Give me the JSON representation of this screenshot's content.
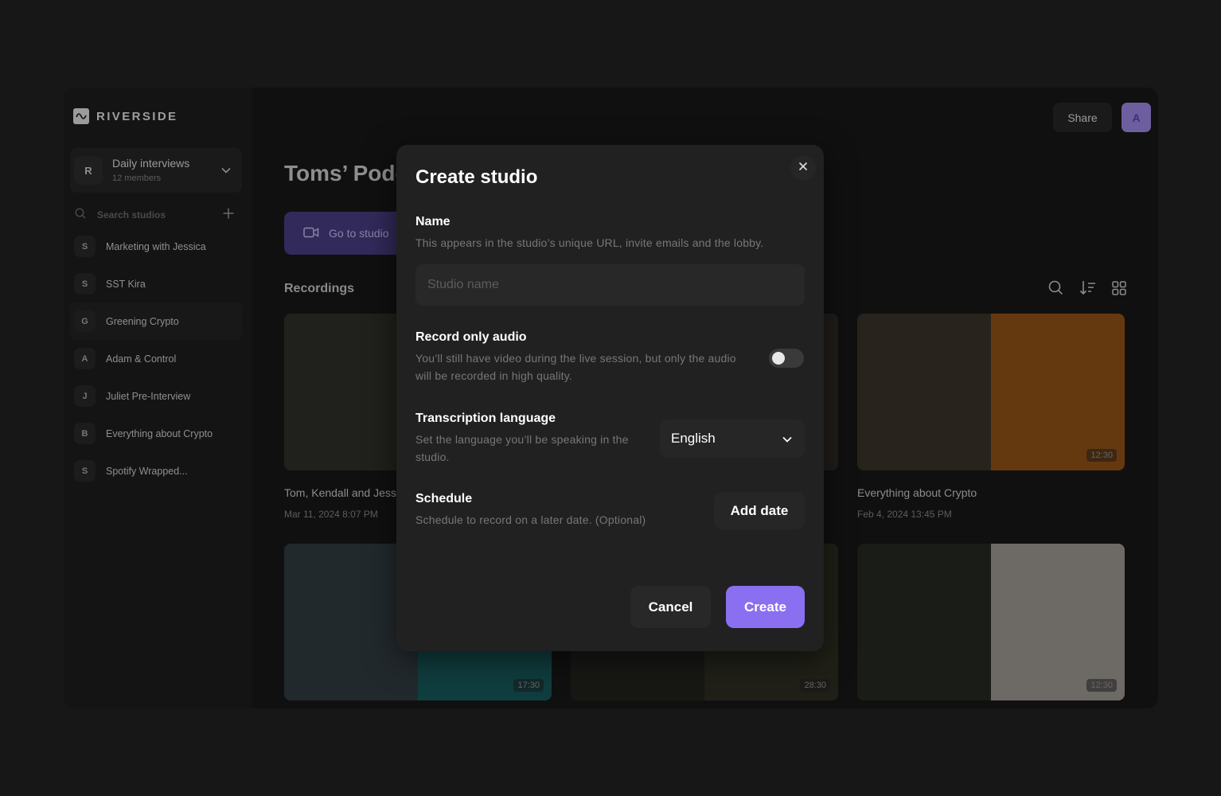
{
  "app": {
    "logo_text": "RIVERSIDE",
    "logo_icon": "waveform-icon"
  },
  "workspace": {
    "initial": "R",
    "name": "Daily interviews",
    "members": "12 members"
  },
  "sidebar": {
    "search_placeholder": "Search studios",
    "studios": [
      {
        "initial": "S",
        "label": "Marketing with Jessica",
        "active": false
      },
      {
        "initial": "S",
        "label": "SST Kira",
        "active": false
      },
      {
        "initial": "G",
        "label": "Greening Crypto",
        "active": true
      },
      {
        "initial": "A",
        "label": "Adam & Control",
        "active": false
      },
      {
        "initial": "J",
        "label": "Juliet Pre-Interview",
        "active": false
      },
      {
        "initial": "B",
        "label": "Everything about Crypto",
        "active": false
      },
      {
        "initial": "S",
        "label": "Spotify Wrapped...",
        "active": false
      }
    ]
  },
  "header": {
    "share_label": "Share",
    "avatar_initial": "A"
  },
  "main": {
    "page_title": "Toms’ Podcast",
    "goto_label": "Go to studio",
    "recordings_title": "Recordings",
    "recordings": [
      {
        "title": "Tom, Kendall and Jessica",
        "date": "Mar 11, 2024 8:07 PM",
        "duration": "",
        "colors": [
          "#3b3a33",
          "#8a5a2a"
        ]
      },
      {
        "title": "",
        "date": "",
        "duration": "",
        "colors": [
          "#2d2a26",
          "#3a352d"
        ]
      },
      {
        "title": "Everything about Crypto",
        "date": "Feb 4, 2024 13:45 PM",
        "duration": "12:30",
        "colors": [
          "#4a4036",
          "#b8671e"
        ]
      },
      {
        "title": "",
        "date": "",
        "duration": "17:30",
        "colors": [
          "#3d4a52",
          "#1d6e70"
        ]
      },
      {
        "title": "",
        "date": "",
        "duration": "28:30",
        "colors": [
          "#2a2924",
          "#3b3a2c"
        ]
      },
      {
        "title": "",
        "date": "",
        "duration": "12:30",
        "colors": [
          "#2f332a",
          "#c6bfb5"
        ]
      }
    ]
  },
  "modal": {
    "title": "Create studio",
    "name_label": "Name",
    "name_desc": "This appears in the studio’s unique URL, invite emails and the lobby.",
    "name_placeholder": "Studio name",
    "name_value": "",
    "audio_label": "Record only audio",
    "audio_desc": "You’ll still have video during the live session, but only the audio will be recorded in high quality.",
    "audio_enabled": false,
    "lang_label": "Transcription language",
    "lang_desc": "Set the language you’ll be speaking in the studio.",
    "lang_value": "English",
    "schedule_label": "Schedule",
    "schedule_desc": "Schedule to record on a later date. (Optional)",
    "add_date_label": "Add date",
    "cancel_label": "Cancel",
    "create_label": "Create"
  },
  "colors": {
    "accent": "#8a6ff0",
    "background": "#171717",
    "modal": "#212121"
  }
}
